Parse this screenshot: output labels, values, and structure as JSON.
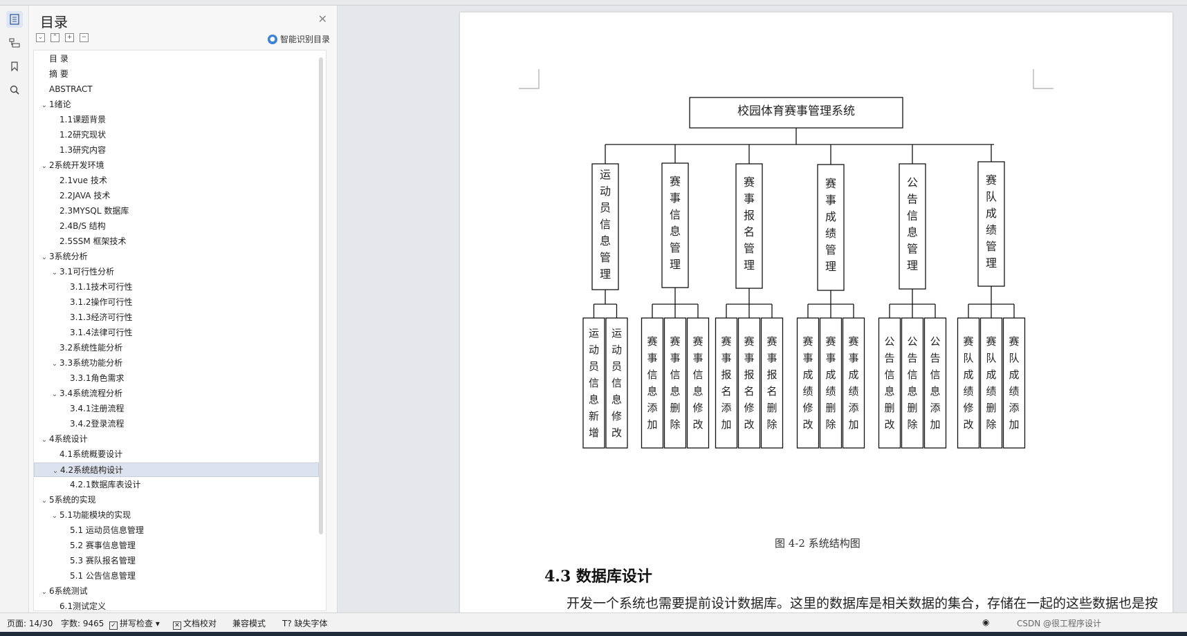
{
  "toc": {
    "title": "目录",
    "smart_label": "智能识别目录",
    "items": [
      {
        "label": "目 录",
        "level": 0,
        "arrow": ""
      },
      {
        "label": "摘  要",
        "level": 0,
        "arrow": ""
      },
      {
        "label": "ABSTRACT",
        "level": 0,
        "arrow": ""
      },
      {
        "label": "1绪论",
        "level": 0,
        "arrow": "v"
      },
      {
        "label": "1.1课题背景",
        "level": 1,
        "arrow": ""
      },
      {
        "label": "1.2研究现状",
        "level": 1,
        "arrow": ""
      },
      {
        "label": "1.3研究内容",
        "level": 1,
        "arrow": ""
      },
      {
        "label": "2系统开发环境",
        "level": 0,
        "arrow": "v"
      },
      {
        "label": "2.1vue 技术",
        "level": 1,
        "arrow": ""
      },
      {
        "label": "2.2JAVA 技术",
        "level": 1,
        "arrow": ""
      },
      {
        "label": "2.3MYSQL 数据库",
        "level": 1,
        "arrow": ""
      },
      {
        "label": "2.4B/S 结构",
        "level": 1,
        "arrow": ""
      },
      {
        "label": "2.5SSM 框架技术",
        "level": 1,
        "arrow": ""
      },
      {
        "label": "3系统分析",
        "level": 0,
        "arrow": "v"
      },
      {
        "label": "3.1可行性分析",
        "level": 1,
        "arrow": "v"
      },
      {
        "label": "3.1.1技术可行性",
        "level": 2,
        "arrow": ""
      },
      {
        "label": "3.1.2操作可行性",
        "level": 2,
        "arrow": ""
      },
      {
        "label": "3.1.3经济可行性",
        "level": 2,
        "arrow": ""
      },
      {
        "label": "3.1.4法律可行性",
        "level": 2,
        "arrow": ""
      },
      {
        "label": "3.2系统性能分析",
        "level": 1,
        "arrow": ""
      },
      {
        "label": "3.3系统功能分析",
        "level": 1,
        "arrow": "v"
      },
      {
        "label": "3.3.1角色需求",
        "level": 2,
        "arrow": ""
      },
      {
        "label": "3.4系统流程分析",
        "level": 1,
        "arrow": "v"
      },
      {
        "label": "3.4.1注册流程",
        "level": 2,
        "arrow": ""
      },
      {
        "label": "3.4.2登录流程",
        "level": 2,
        "arrow": ""
      },
      {
        "label": "4系统设计",
        "level": 0,
        "arrow": "v"
      },
      {
        "label": "4.1系统概要设计",
        "level": 1,
        "arrow": ""
      },
      {
        "label": "4.2系统结构设计",
        "level": 1,
        "arrow": "v",
        "selected": true
      },
      {
        "label": "4.2.1数据库表设计",
        "level": 2,
        "arrow": ""
      },
      {
        "label": "5系统的实现",
        "level": 0,
        "arrow": "v"
      },
      {
        "label": "5.1功能模块的实现",
        "level": 1,
        "arrow": "v"
      },
      {
        "label": "5.1 运动员信息管理",
        "level": 2,
        "arrow": ""
      },
      {
        "label": "5.2  赛事信息管理",
        "level": 2,
        "arrow": ""
      },
      {
        "label": "5.3 赛队报名管理",
        "level": 2,
        "arrow": ""
      },
      {
        "label": "5.1 公告信息管理",
        "level": 2,
        "arrow": ""
      },
      {
        "label": "6系统测试",
        "level": 0,
        "arrow": "v"
      },
      {
        "label": "6.1测试定义",
        "level": 1,
        "arrow": ""
      }
    ]
  },
  "diagram": {
    "root": "校园体育赛事管理系统",
    "modules": [
      {
        "name": "运动员信息管理",
        "children": [
          "运动员信息新增",
          "运动员信息修改"
        ]
      },
      {
        "name": "赛事信息管理",
        "children": [
          "赛事信息添加",
          "赛事信息删除",
          "赛事信息修改"
        ]
      },
      {
        "name": "赛事报名管理",
        "children": [
          "赛事报名添加",
          "赛事报名修改",
          "赛事报名删除"
        ]
      },
      {
        "name": "赛事成绩管理",
        "children": [
          "赛事成绩修改",
          "赛事成绩删除",
          "赛事成绩添加"
        ]
      },
      {
        "name": "公告信息管理",
        "children": [
          "公告信息删改",
          "公告信息删除",
          "公告信息添加"
        ]
      },
      {
        "name": "赛队成绩管理",
        "children": [
          "赛队成绩修改",
          "赛队成绩删除",
          "赛队成绩添加"
        ]
      }
    ],
    "caption": "图 4-2  系统结构图"
  },
  "doc": {
    "heading": "4.3  数据库设计",
    "paragraph": "开发一个系统也需要提前设计数据库。这里的数据库是相关数据的集合，存储在一起的这些数据也是按照一定的组织方式进行的。目前，数据库能够服务于多种应用程序"
  },
  "status": {
    "page": "页面: 14/30",
    "words": "字数: 9465",
    "spell": "拼写检查",
    "doc_check": "文档校对",
    "compat": "兼容模式",
    "missing_font": "缺失字体",
    "watermark": "CSDN @很工程序设计"
  }
}
